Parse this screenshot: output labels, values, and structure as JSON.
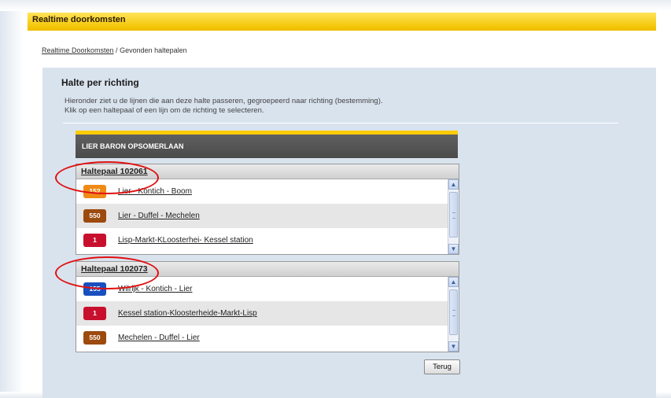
{
  "header": {
    "title": "Realtime doorkomsten"
  },
  "breadcrumb": {
    "link": "Realtime Doorkomsten",
    "separator": " / ",
    "current": "Gevonden haltepalen"
  },
  "section": {
    "title": "Halte per richting",
    "desc_line1": "Hieronder ziet u de lijnen die aan deze halte passeren, gegroepeerd naar richting (bestemming).",
    "desc_line2": "Klik op een haltepaal of een lijn om de richting te selecteren."
  },
  "panel": {
    "stop_name": "LIER BARON OPSOMERLAAN"
  },
  "stops": [
    {
      "title": "Haltepaal 102061",
      "lines": [
        {
          "number": "152",
          "label": "Lier - Kontich - Boom",
          "color": "#ef8a17"
        },
        {
          "number": "550",
          "label": "Lier - Duffel - Mechelen",
          "color": "#9c4a0e"
        },
        {
          "number": "1",
          "label": "Lisp-Markt-KLoosterhei- Kessel station",
          "color": "#c8102e"
        }
      ]
    },
    {
      "title": "Haltepaal 102073",
      "lines": [
        {
          "number": "155",
          "label": "Wilrijk - Kontich - Lier",
          "color": "#1a4fc0"
        },
        {
          "number": "1",
          "label": "Kessel station-Kloosterheide-Markt-Lisp",
          "color": "#c8102e"
        },
        {
          "number": "550",
          "label": "Mechelen - Duffel - Lier",
          "color": "#9c4a0e"
        }
      ]
    }
  ],
  "buttons": {
    "back": "Terug"
  },
  "icons": {
    "scroll_up": "scroll-up-arrow-icon",
    "scroll_down": "scroll-down-arrow-icon"
  },
  "colors": {
    "accent": "#ffcc00",
    "panel_bg": "#d9e3ee",
    "highlight_ellipse": "#e01010"
  }
}
